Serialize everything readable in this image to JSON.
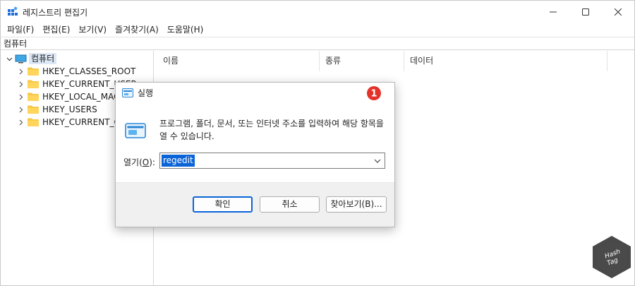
{
  "window": {
    "title": "레지스트리 편집기",
    "controls": {
      "minimize": "─",
      "maximize": "☐",
      "close": "✕"
    }
  },
  "menubar": {
    "items": [
      "파일(F)",
      "편집(E)",
      "보기(V)",
      "즐겨찾기(A)",
      "도움말(H)"
    ]
  },
  "addressbar": {
    "path": "컴퓨터"
  },
  "tree": {
    "root": "컴퓨터",
    "children": [
      "HKEY_CLASSES_ROOT",
      "HKEY_CURRENT_USER",
      "HKEY_LOCAL_MACHINE",
      "HKEY_USERS",
      "HKEY_CURRENT_CONFIG"
    ]
  },
  "list": {
    "columns": [
      "이름",
      "종류",
      "데이터"
    ]
  },
  "run_dialog": {
    "title": "실행",
    "description": "프로그램, 폴더, 문서, 또는 인터넷 주소를 입력하여 해당 항목을 열 수 있습니다.",
    "open_label_prefix": "열기(",
    "open_label_key": "O",
    "open_label_suffix": "):",
    "open_value": "regedit",
    "buttons": {
      "ok": "확인",
      "cancel": "취소",
      "browse": "찾아보기(B)..."
    }
  },
  "marker": {
    "number": "1",
    "color": "#e4322b"
  },
  "colors": {
    "accent": "#0a64d8",
    "folder": "#f5c542",
    "marker": "#e4322b"
  },
  "watermark": {
    "line1": "Hash",
    "line2": "Tag"
  }
}
